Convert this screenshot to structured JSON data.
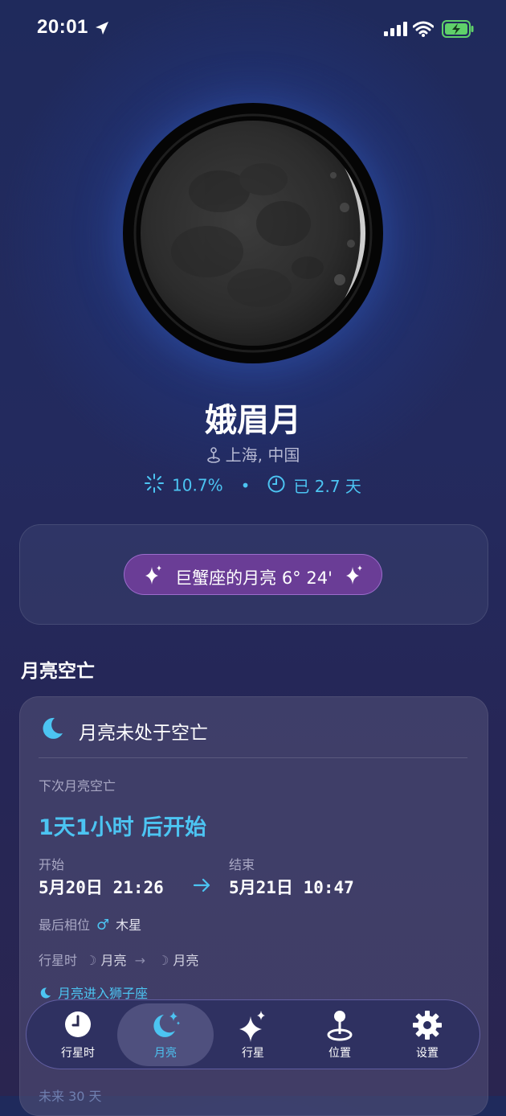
{
  "status_bar": {
    "time": "20:01"
  },
  "moon": {
    "phase_name": "娥眉月",
    "location": "上海, 中国",
    "illumination": "10.7%",
    "age": "已 2.7 天",
    "zodiac": "巨蟹座的月亮 6° 24'"
  },
  "void": {
    "section_title": "月亮空亡",
    "status": "月亮未处于空亡",
    "next_label": "下次月亮空亡",
    "countdown": "1天1小时 后开始",
    "start_label": "开始",
    "start_value": "5月20日 21:26",
    "end_label": "结束",
    "end_value": "5月21日 10:47",
    "last_aspect_label": "最后相位",
    "last_aspect_symbol": "♂",
    "last_aspect_planet": "木星",
    "planet_hour_label": "行星时",
    "planet_hour_from_symbol": "☽",
    "planet_hour_from": "月亮",
    "planet_hour_arrow": "→",
    "planet_hour_to_symbol": "☽",
    "planet_hour_to": "月亮",
    "enter_sign": "月亮进入狮子座",
    "future_link": "未来 30 天"
  },
  "tabs": [
    {
      "id": "planet-hour",
      "label": "行星时",
      "icon": "clock-icon"
    },
    {
      "id": "moon",
      "label": "月亮",
      "icon": "moon-stars-icon",
      "active": true
    },
    {
      "id": "planets",
      "label": "行星",
      "icon": "sparkles-icon"
    },
    {
      "id": "location",
      "label": "位置",
      "icon": "pin-icon"
    },
    {
      "id": "settings",
      "label": "设置",
      "icon": "gear-icon"
    }
  ],
  "colors": {
    "accent": "#4cc4f2",
    "pill": "#6a3d96"
  }
}
